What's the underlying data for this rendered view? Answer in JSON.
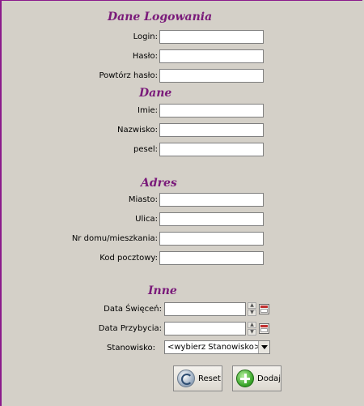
{
  "sections": {
    "login": "Dane Logowania",
    "dane": "Dane",
    "adres": "Adres",
    "inne": "Inne"
  },
  "labels": {
    "login": "Login:",
    "haslo": "Hasło:",
    "powtorz_haslo": "Powtórz hasło:",
    "imie": "Imie:",
    "nazwisko": "Nazwisko:",
    "pesel": "pesel:",
    "miasto": "Miasto:",
    "ulica": "Ulica:",
    "nr_domu": "Nr domu/mieszkania:",
    "kod_pocztowy": "Kod pocztowy:",
    "data_swiecen": "Data Święceń:",
    "data_przybycia": "Data Przybycia:",
    "stanowisko": "Stanowisko:"
  },
  "fields": {
    "login": "",
    "haslo": "",
    "powtorz_haslo": "",
    "imie": "",
    "nazwisko": "",
    "pesel": "",
    "miasto": "",
    "ulica": "",
    "nr_domu": "",
    "kod_pocztowy": "",
    "data_swiecen": "",
    "data_przybycia": ""
  },
  "stanowisko_selected": "<wybierz Stanowisko>",
  "buttons": {
    "reset": "Reset",
    "dodaj": "Dodaj"
  },
  "icons": {
    "reset": "refresh-icon",
    "dodaj": "add-icon",
    "calendar": "calendar-icon"
  },
  "colors": {
    "section_title": "#7a1a7a",
    "background": "#d4d0c8",
    "frame": "#8b1a8b"
  }
}
